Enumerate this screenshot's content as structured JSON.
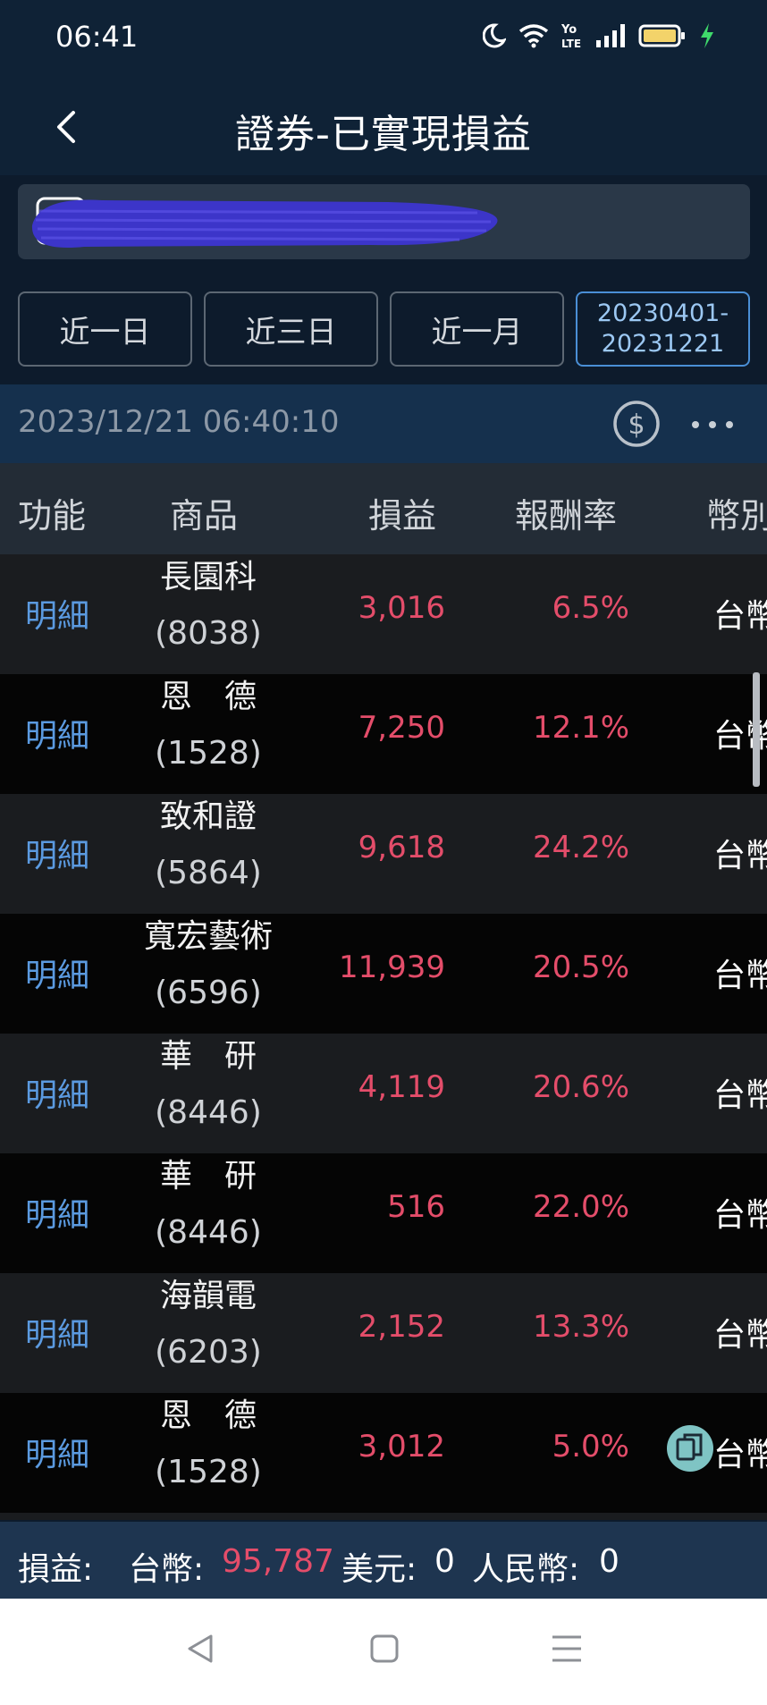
{
  "status_bar": {
    "time": "06:41",
    "icons": [
      "moon-icon",
      "wifi-icon",
      "volte-icon",
      "signal-icon",
      "battery-icon",
      "charging-icon"
    ]
  },
  "header": {
    "title": "證券-已實現損益",
    "back_icon": "chevron-left-icon"
  },
  "period_buttons": [
    {
      "label": "近一日",
      "active": false
    },
    {
      "label": "近三日",
      "active": false
    },
    {
      "label": "近一月",
      "active": false
    },
    {
      "label_line1": "20230401-",
      "label_line2": "20231221",
      "active": true
    }
  ],
  "info_bar": {
    "timestamp": "2023/12/21 06:40:10",
    "icons": [
      "dollar-circle-icon",
      "more-horizontal-icon"
    ]
  },
  "table": {
    "headers": [
      "功能",
      "商品",
      "損益",
      "報酬率",
      "幣別"
    ],
    "rows": [
      {
        "func": "明細",
        "name": "長園科",
        "code": "(8038)",
        "pnl": "3,016",
        "ret": "6.5%",
        "cur": "台幣"
      },
      {
        "func": "明細",
        "name": "恩　德",
        "code": "(1528)",
        "pnl": "7,250",
        "ret": "12.1%",
        "cur": "台幣"
      },
      {
        "func": "明細",
        "name": "致和證",
        "code": "(5864)",
        "pnl": "9,618",
        "ret": "24.2%",
        "cur": "台幣"
      },
      {
        "func": "明細",
        "name": "寬宏藝術",
        "code": "(6596)",
        "pnl": "11,939",
        "ret": "20.5%",
        "cur": "台幣"
      },
      {
        "func": "明細",
        "name": "華　研",
        "code": "(8446)",
        "pnl": "4,119",
        "ret": "20.6%",
        "cur": "台幣"
      },
      {
        "func": "明細",
        "name": "華　研",
        "code": "(8446)",
        "pnl": "516",
        "ret": "22.0%",
        "cur": "台幣"
      },
      {
        "func": "明細",
        "name": "海韻電",
        "code": "(6203)",
        "pnl": "2,152",
        "ret": "13.3%",
        "cur": "台幣"
      },
      {
        "func": "明細",
        "name": "恩　德",
        "code": "(1528)",
        "pnl": "3,012",
        "ret": "5.0%",
        "cur": "台幣"
      }
    ]
  },
  "summary": {
    "label": "損益:",
    "twd_label": "台幣:",
    "twd_value": "95,787",
    "usd_label": "美元:",
    "usd_value": "0",
    "rmb_label": "人民幣:",
    "rmb_value": "0"
  },
  "colors": {
    "positive": "#e44d6a",
    "link": "#5b9ae0",
    "accent_border": "#4a8fd6"
  },
  "system_nav": [
    "back-triangle-icon",
    "home-square-icon",
    "recents-menu-icon"
  ]
}
